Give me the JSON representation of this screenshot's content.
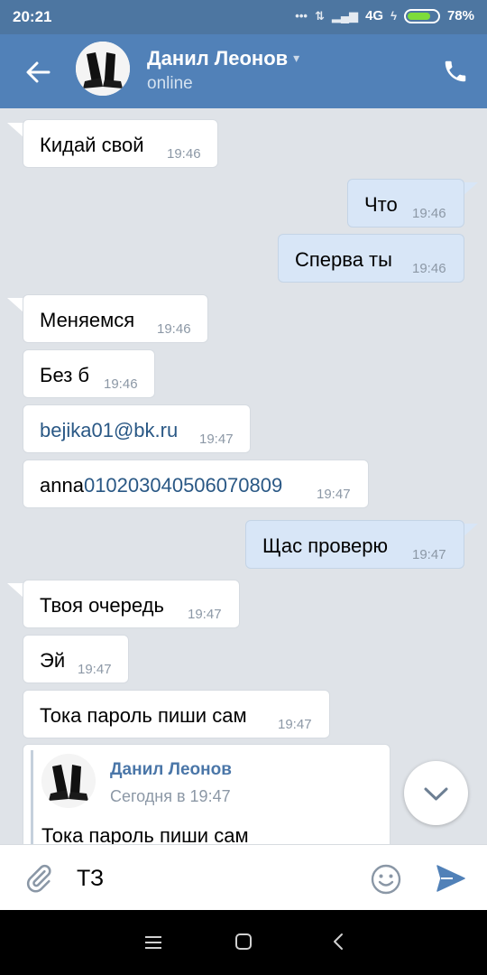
{
  "status_bar": {
    "time": "20:21",
    "network": "4G",
    "battery": "78%",
    "battery_level": 0.78
  },
  "header": {
    "name": "Данил Леонов",
    "status": "online",
    "icons": [
      "back-arrow-icon",
      "chevron-down-icon",
      "phone-icon"
    ]
  },
  "messages": [
    {
      "dir": "in",
      "text": "Кидай свой",
      "time": "19:46"
    },
    {
      "dir": "out",
      "text": "Что",
      "time": "19:46"
    },
    {
      "dir": "out",
      "text": "Сперва ты",
      "time": "19:46"
    },
    {
      "dir": "in",
      "text": "Меняемся",
      "time": "19:46"
    },
    {
      "dir": "in",
      "text": "Без б",
      "time": "19:46"
    },
    {
      "dir": "in",
      "text": "bejika01@bk.ru",
      "time": "19:47"
    },
    {
      "dir": "in",
      "text_prefix": "anna",
      "text_link": "010203040506070809",
      "time": "19:47"
    },
    {
      "dir": "out",
      "text": "Щас проверю",
      "time": "19:47"
    },
    {
      "dir": "in",
      "text": "Твоя очередь",
      "time": "19:47"
    },
    {
      "dir": "in",
      "text": "Эй",
      "time": "19:47"
    },
    {
      "dir": "in",
      "text": "Тока пароль пиши сам",
      "time": "19:47"
    }
  ],
  "forwarded": {
    "name": "Данил Леонов",
    "date": "Сегодня в 19:47",
    "text": "Тока пароль пиши сам"
  },
  "composer": {
    "value": "ТЗ",
    "icons": [
      "paperclip-icon",
      "smile-icon",
      "send-icon"
    ]
  },
  "colors": {
    "header": "#5181b8",
    "status_bar": "#4d76a1",
    "chat_bg": "#dfe3e8",
    "incoming_bubble": "#ffffff",
    "outgoing_bubble": "#d8e6f7",
    "link": "#2a5885",
    "accent": "#4a76a8"
  }
}
